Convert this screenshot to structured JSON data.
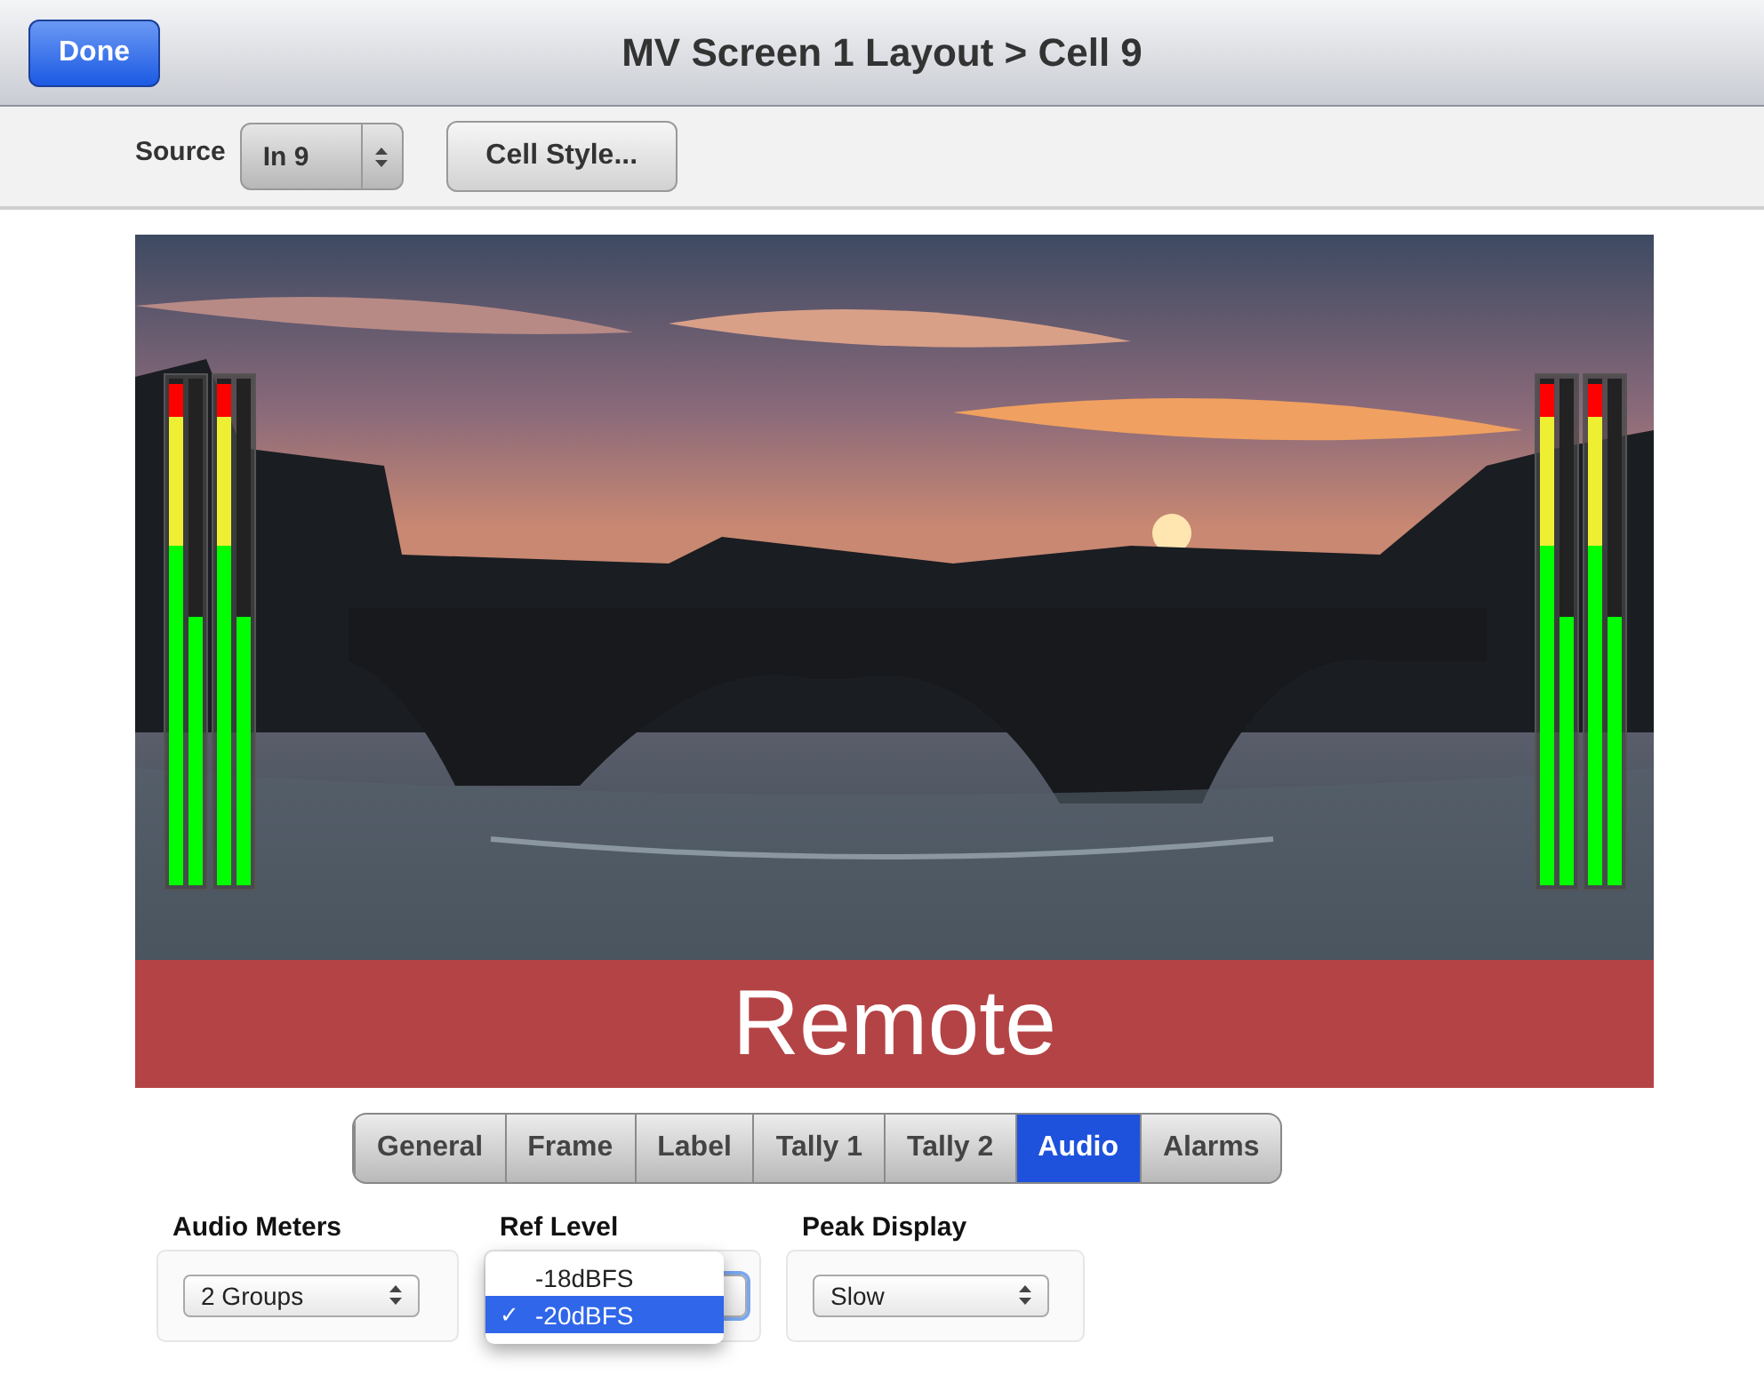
{
  "header": {
    "done_button": "Done",
    "title": "MV Screen 1 Layout > Cell 9"
  },
  "toolbar": {
    "source_label": "Source",
    "source_value": "In 9",
    "cell_style_button": "Cell Style..."
  },
  "preview": {
    "kind": "picture",
    "label": "Remote",
    "meter_groups": [
      {
        "bars": [
          {
            "level": 0.99
          },
          {
            "level": 0.53
          },
          {
            "level": 0.99
          },
          {
            "level": 0.53
          }
        ]
      },
      {
        "bars": [
          {
            "level": 0.99
          },
          {
            "level": 0.53
          },
          {
            "level": 0.99
          },
          {
            "level": 0.53
          }
        ]
      }
    ]
  },
  "tabs": [
    {
      "label": "General",
      "selected": false
    },
    {
      "label": "Frame",
      "selected": false
    },
    {
      "label": "Label",
      "selected": false
    },
    {
      "label": "Tally 1",
      "selected": false
    },
    {
      "label": "Tally 2",
      "selected": false
    },
    {
      "label": "Audio",
      "selected": true
    },
    {
      "label": "Alarms",
      "selected": false
    }
  ],
  "settings": [
    {
      "label": "Audio Meters",
      "value": "2 Groups"
    },
    {
      "label": "Ref Level",
      "menu": [
        {
          "label": "-18dBFS",
          "selected": false
        },
        {
          "label": "-20dBFS",
          "selected": true,
          "check": "✓"
        }
      ]
    },
    {
      "label": "Peak Display",
      "value": "Slow"
    }
  ]
}
